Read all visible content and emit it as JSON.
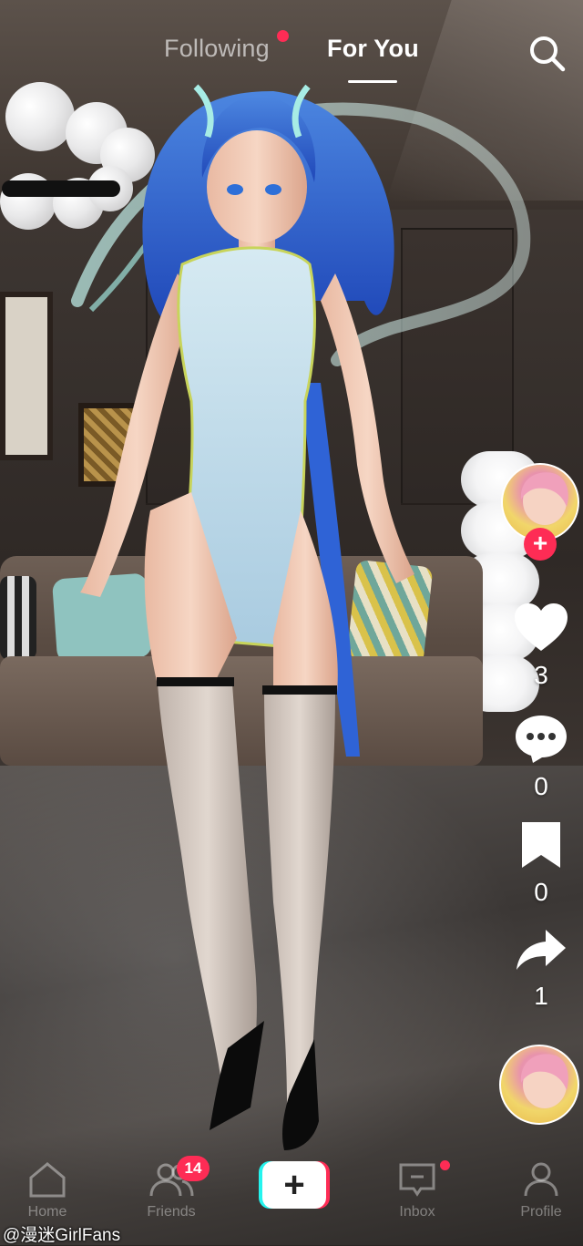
{
  "header": {
    "tabs": [
      {
        "label": "Following",
        "has_dot": true
      },
      {
        "label": "For You",
        "active": true
      }
    ],
    "search_icon": "search-icon"
  },
  "rail": {
    "like_count": "3",
    "comment_count": "0",
    "bookmark_count": "0",
    "share_count": "1",
    "follow_symbol": "+"
  },
  "nav": {
    "items": [
      {
        "label": "Home",
        "icon": "home-icon"
      },
      {
        "label": "Friends",
        "icon": "friends-icon",
        "badge": "14"
      },
      {
        "label": "",
        "icon": "plus-icon",
        "symbol": "+"
      },
      {
        "label": "Inbox",
        "icon": "inbox-icon",
        "has_dot": true
      },
      {
        "label": "Profile",
        "icon": "profile-icon"
      }
    ]
  },
  "watermark": "@漫迷GirlFans",
  "colors": {
    "accent": "#fe2c55",
    "cyan": "#25f4ee",
    "text": "#ffffff"
  }
}
